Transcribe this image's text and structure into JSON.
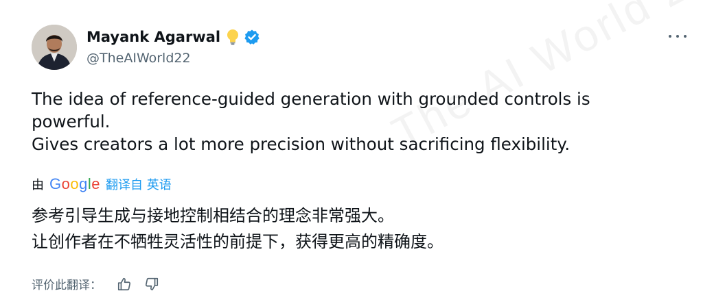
{
  "tweet": {
    "author": {
      "display_name": "Mayank Agarwal",
      "handle": "@TheAIWorld22",
      "verified": true
    },
    "text_lines": [
      "The idea of reference-guided generation with grounded controls is powerful.",
      "Gives creators a lot more precision without sacrificing flexibility."
    ],
    "translation": {
      "by_label": "由",
      "provider": "Google",
      "link_label": "翻译自 英语",
      "lines": [
        "参考引导生成与接地控制相结合的理念非常强大。",
        "让创作者在不牺牲灵活性的前提下，获得更高的精确度。"
      ]
    },
    "rate": {
      "label": "评价此翻译："
    }
  },
  "colors": {
    "accent": "#1d9bf0",
    "secondary_text": "#536471",
    "verified": "#1d9bf0"
  },
  "icons": [
    "light-bulb-icon",
    "verified-badge-icon",
    "more-options-icon",
    "thumbs-up-icon",
    "thumbs-down-icon"
  ]
}
